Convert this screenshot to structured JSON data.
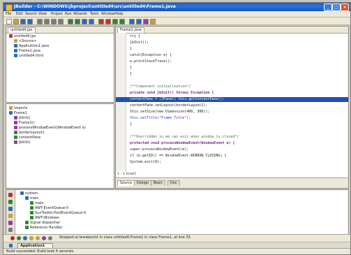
{
  "window": {
    "title": "JBuilder - C:\\WINDOWS\\jbproject\\untitled4\\src\\untitled4\\Frame1.java",
    "buttons": [
      "_",
      "□",
      "×"
    ]
  },
  "menu": [
    "File",
    "Edit",
    "Search",
    "View",
    "Project",
    "Run",
    "Wizards",
    "Tools",
    "Window",
    "Help"
  ],
  "toolbar": {
    "icons": [
      "new-icon",
      "open-icon",
      "save-icon",
      "save-all-icon",
      "print-icon",
      "cut-icon",
      "copy-icon",
      "paste-icon",
      "undo-icon",
      "redo-icon",
      "find-icon",
      "replace-icon",
      "make-icon",
      "rebuild-icon",
      "run-icon",
      "debug-icon",
      "back-icon",
      "forward-icon",
      "browse-icon",
      "help-icon"
    ]
  },
  "project_pane": {
    "tab": "untitled4.jpx",
    "tree": [
      {
        "label": "untitled4.jpx",
        "indent": 0,
        "color": "#c43030"
      },
      {
        "label": "<Source>",
        "indent": 1,
        "color": "#c9a030"
      },
      {
        "label": "Application1.java",
        "indent": 1,
        "color": "#2a6ab8"
      },
      {
        "label": "Frame1.java",
        "indent": 1,
        "color": "#2a6ab8"
      },
      {
        "label": "untitled4.html",
        "indent": 1,
        "color": "#2a6ab8"
      }
    ]
  },
  "structure_pane": {
    "tree": [
      {
        "label": "Imports",
        "indent": 0,
        "color": "#c9a030"
      },
      {
        "label": "Frame1",
        "indent": 0,
        "color": "#2a6ab8"
      },
      {
        "label": "jbInit()",
        "indent": 1,
        "color": "#9a3a9a"
      },
      {
        "label": "Frame1()",
        "indent": 1,
        "color": "#9a3a9a"
      },
      {
        "label": "processWindowEvent(WindowEvent e)",
        "indent": 1,
        "color": "#9a3a9a"
      },
      {
        "label": "borderLayout1",
        "indent": 1,
        "color": "#2a8a2a"
      },
      {
        "label": "contentPane",
        "indent": 1,
        "color": "#2a8a2a"
      },
      {
        "label": "jbInit()",
        "indent": 1,
        "color": "#9a3a9a"
      }
    ]
  },
  "editor": {
    "tab": "Frame1.java",
    "status": "1 : 1 Insert",
    "bottom_tabs": [
      "Source",
      "Design",
      "Bean",
      "Doc"
    ],
    "lines": [
      {
        "t": "    try {",
        "cls": ""
      },
      {
        "t": "      jbInit();",
        "cls": ""
      },
      {
        "t": "    }",
        "cls": ""
      },
      {
        "t": "    catch(Exception e) {",
        "cls": ""
      },
      {
        "t": "      e.printStackTrace();",
        "cls": ""
      },
      {
        "t": "    }",
        "cls": ""
      },
      {
        "t": "  }",
        "cls": ""
      },
      {
        "t": "",
        "cls": ""
      },
      {
        "t": "  /**Component initialization*/",
        "cls": "cm"
      },
      {
        "t": "  private void jbInit() throws Exception  {",
        "cls": "kw"
      },
      {
        "t": "    contentPane = (JPanel) this.getContentPane();",
        "cls": "hl"
      },
      {
        "t": "    contentPane.setLayout(borderLayout1);",
        "cls": ""
      },
      {
        "t": "    this.setSize(new Dimension(400, 300));",
        "cls": ""
      },
      {
        "t": "    this.setTitle(\"Frame Title\");",
        "cls": "st"
      },
      {
        "t": "  }",
        "cls": ""
      },
      {
        "t": "",
        "cls": ""
      },
      {
        "t": "  /**Overridden so we can exit when window is closed*/",
        "cls": "cm"
      },
      {
        "t": "  protected void processWindowEvent(WindowEvent e) {",
        "cls": "kw"
      },
      {
        "t": "    super.processWindowEvent(e);",
        "cls": ""
      },
      {
        "t": "    if (e.getID() == WindowEvent.WINDOW_CLOSING) {",
        "cls": ""
      },
      {
        "t": "      System.exit(0);",
        "cls": ""
      }
    ]
  },
  "debug_pane": {
    "tree": [
      {
        "label": "system",
        "indent": 0,
        "color": "#2a6ab8"
      },
      {
        "label": "main",
        "indent": 1,
        "color": "#2a6ab8"
      },
      {
        "label": "main",
        "indent": 2,
        "color": "#2a8a2a"
      },
      {
        "label": "AWT-EventQueue-0",
        "indent": 2,
        "color": "#2a8a2a"
      },
      {
        "label": "SunToolkit.PostEventQueue-0",
        "indent": 2,
        "color": "#2a8a2a"
      },
      {
        "label": "AWT-Windows",
        "indent": 2,
        "color": "#2a8a2a"
      },
      {
        "label": "Signal dispatcher",
        "indent": 1,
        "color": "#2a8a2a"
      },
      {
        "label": "Reference Handler",
        "indent": 1,
        "color": "#2a8a2a"
      }
    ]
  },
  "bottom_status": "Stopped at breakpoint in class untitled4.Frame1 in class Frame1, at line 33.",
  "taskbar": {
    "button": "Application1"
  },
  "statusbar": "Build succeeded. Build took 6 seconds."
}
